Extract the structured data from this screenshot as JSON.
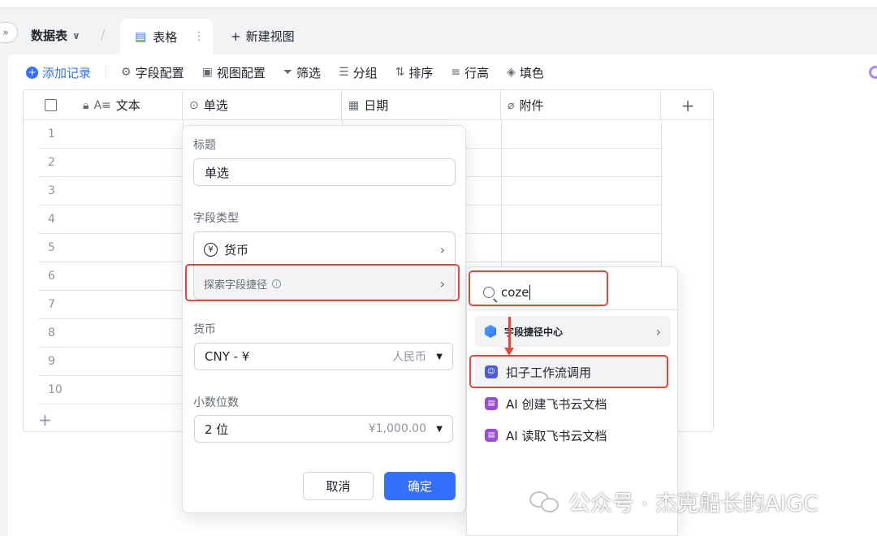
{
  "tabs": {
    "collapse_icon": "»",
    "datasheet_title": "数据表",
    "separator": "/",
    "active_tab_label": "表格",
    "new_view_label": "新建视图"
  },
  "toolbar": {
    "add_record": "添加记录",
    "field_config": "字段配置",
    "view_config": "视图配置",
    "filter": "筛选",
    "group": "分组",
    "sort": "排序",
    "row_height": "行高",
    "fill_color": "填色"
  },
  "grid": {
    "columns": [
      {
        "label": "文本",
        "icon": "text-icon"
      },
      {
        "label": "单选",
        "icon": "single-select-icon"
      },
      {
        "label": "日期",
        "icon": "date-icon"
      },
      {
        "label": "附件",
        "icon": "attachment-icon"
      }
    ],
    "rows": [
      "1",
      "2",
      "3",
      "4",
      "5",
      "6",
      "7",
      "8",
      "9",
      "10"
    ]
  },
  "panel": {
    "title_label": "标题",
    "title_value": "单选",
    "field_type_label": "字段类型",
    "type_value": "货币",
    "explore_label": "探索字段捷径",
    "currency_label": "货币",
    "currency_value": "CNY - ¥",
    "currency_hint": "人民币",
    "decimal_label": "小数位数",
    "decimal_value": "2 位",
    "decimal_hint": "¥1,000.00",
    "cancel": "取消",
    "confirm": "确定"
  },
  "submenu": {
    "search_value": "coze",
    "hub_label": "字段捷径中心",
    "items": [
      "扣子工作流调用",
      "AI 创建飞书云文档",
      "AI 读取飞书云文档"
    ]
  },
  "watermark": "公众号 · 杰克船长的AIGC",
  "colors": {
    "accent": "#3370ff",
    "annotation_red": "#e0483a"
  }
}
